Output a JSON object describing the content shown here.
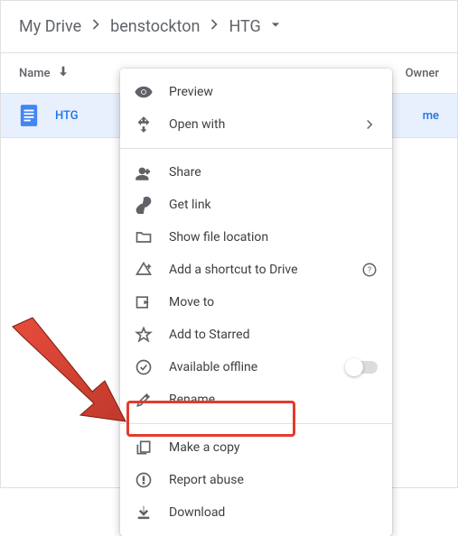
{
  "breadcrumb": {
    "items": [
      "My Drive",
      "benstockton",
      "HTG"
    ]
  },
  "columns": {
    "name": "Name",
    "owner": "Owner"
  },
  "file": {
    "name": "HTG",
    "owner": "me"
  },
  "menu": {
    "preview": "Preview",
    "open_with": "Open with",
    "share": "Share",
    "get_link": "Get link",
    "show_location": "Show file location",
    "add_shortcut": "Add a shortcut to Drive",
    "move_to": "Move to",
    "add_starred": "Add to Starred",
    "available_offline": "Available offline",
    "rename": "Rename",
    "make_copy": "Make a copy",
    "report_abuse": "Report abuse",
    "download": "Download"
  }
}
